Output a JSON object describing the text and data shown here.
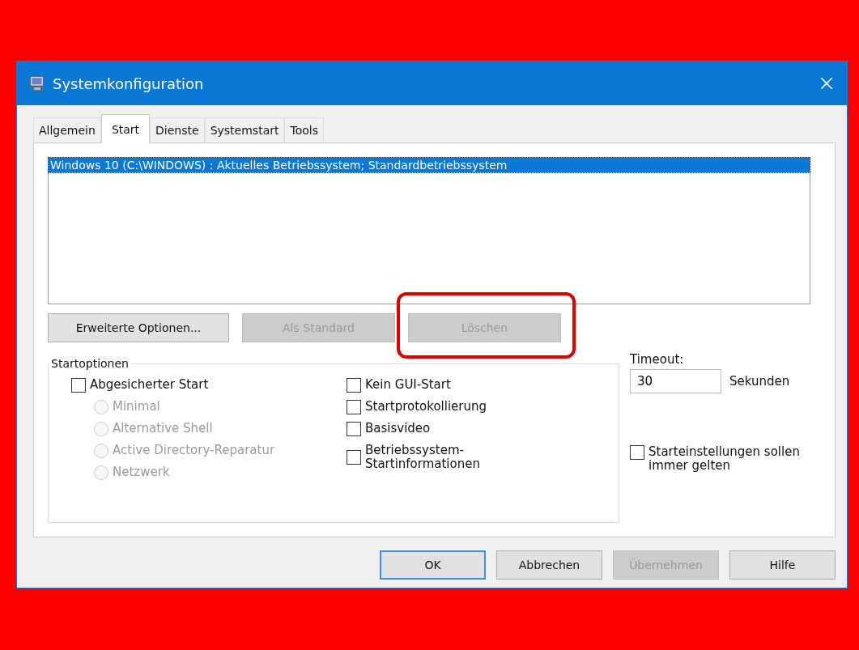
{
  "window": {
    "title": "Systemkonfiguration"
  },
  "tabs": [
    {
      "label": "Allgemein",
      "selected": false
    },
    {
      "label": "Start",
      "selected": true
    },
    {
      "label": "Dienste",
      "selected": false
    },
    {
      "label": "Systemstart",
      "selected": false
    },
    {
      "label": "Tools",
      "selected": false
    }
  ],
  "boot_list": [
    {
      "label": "Windows 10 (C:\\WINDOWS) : Aktuelles Betriebssystem; Standardbetriebssystem",
      "selected": true
    }
  ],
  "list_buttons": [
    {
      "label": "Erweiterte Optionen...",
      "disabled": false,
      "highlighted": false
    },
    {
      "label": "Als Standard",
      "disabled": true,
      "highlighted": false
    },
    {
      "label": "Löschen",
      "disabled": true,
      "highlighted": true
    }
  ],
  "start_options": {
    "title": "Startoptionen",
    "left": [
      {
        "kind": "checkbox",
        "label": "Abgesicherter Start",
        "checked": false,
        "disabled": false
      },
      {
        "kind": "radio",
        "label": "Minimal",
        "selected": false,
        "disabled": true
      },
      {
        "kind": "radio",
        "label": "Alternative Shell",
        "selected": false,
        "disabled": true
      },
      {
        "kind": "radio",
        "label": "Active Directory-Reparatur",
        "selected": false,
        "disabled": true
      },
      {
        "kind": "radio",
        "label": "Netzwerk",
        "selected": false,
        "disabled": true
      }
    ],
    "right": [
      {
        "kind": "checkbox",
        "label": "Kein GUI-Start",
        "checked": false,
        "disabled": false
      },
      {
        "kind": "checkbox",
        "label": "Startprotokollierung",
        "checked": false,
        "disabled": false
      },
      {
        "kind": "checkbox",
        "label": "Basisvideo",
        "checked": false,
        "disabled": false
      },
      {
        "kind": "checkbox",
        "label": "Betriebssystem-\nStartinformationen",
        "checked": false,
        "disabled": false
      }
    ]
  },
  "timeout": {
    "label": "Timeout:",
    "value": "30",
    "unit": "Sekunden"
  },
  "permanent": {
    "label": "Starteinstellungen sollen\nimmer gelten",
    "checked": false
  },
  "buttons": [
    {
      "label": "OK",
      "disabled": false,
      "default": true
    },
    {
      "label": "Abbrechen",
      "disabled": false,
      "default": false
    },
    {
      "label": "Übernehmen",
      "disabled": true,
      "default": false
    },
    {
      "label": "Hilfe",
      "disabled": false,
      "default": false
    }
  ]
}
